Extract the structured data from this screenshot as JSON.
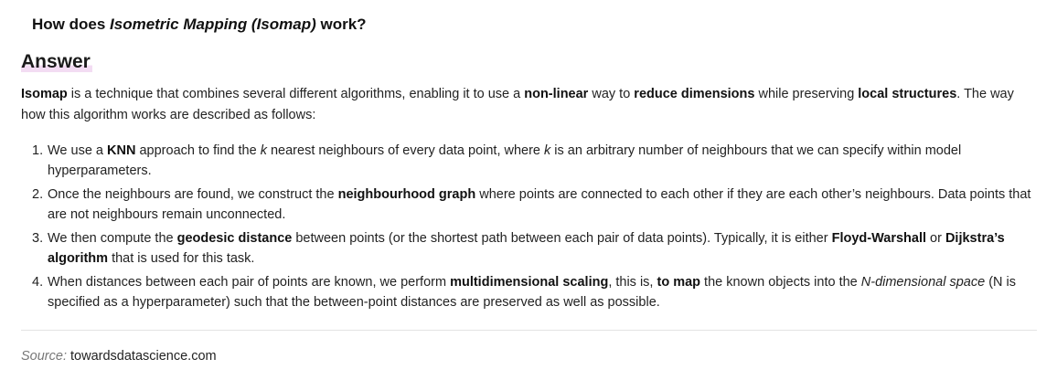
{
  "question": {
    "prefix": "How does ",
    "term": "Isometric Mapping (Isomap)",
    "suffix": " work?"
  },
  "answer_heading": "Answer",
  "intro": {
    "term": "Isomap",
    "t1": " is a technique that combines several different algorithms, enabling it to use a ",
    "b1": "non-linear",
    "t2": " way to ",
    "b2": "reduce dimensions",
    "t3": " while preserving ",
    "b3": "local structures",
    "t4": ". The way how this algorithm works are described as follows:"
  },
  "steps": [
    {
      "num": "1.",
      "t1": "We use a ",
      "b1": "KNN",
      "t2": " approach to find the ",
      "i1": "k",
      "t3": " nearest neighbours of every data point, where ",
      "i2": "k",
      "t4": " is an arbitrary number of neighbours that we can specify within model hyperparameters."
    },
    {
      "num": "2.",
      "t1": "Once the neighbours are found, we construct the ",
      "b1": "neighbourhood graph",
      "t2": " where points are connected to each other if they are each other’s neighbours. Data points that are not neighbours remain unconnected."
    },
    {
      "num": "3.",
      "t1": "We then compute the ",
      "b1": "geodesic distance",
      "t2": " between points (or the shortest path between each pair of data points). Typically, it is either ",
      "b2": "Floyd-Warshall",
      "t3": " or ",
      "b3": "Dijkstra’s algorithm",
      "t4": " that is used for this task."
    },
    {
      "num": "4.",
      "t1": "When distances between each pair of points are known, we perform ",
      "b1": "multidimensional scaling",
      "t2": ", this is, ",
      "b2": "to map",
      "t3": " the known objects into the ",
      "i1": "N-dimensional space",
      "t4": " (N is specified as a hyperparameter) such that the between-point distances are preserved as well as possible."
    }
  ],
  "source": {
    "label": "Source:",
    "value": "towardsdatascience.com"
  },
  "colors": {
    "heading_highlight": "#f3dcf3",
    "divider": "#e3e3e3",
    "source_label": "#777777"
  }
}
